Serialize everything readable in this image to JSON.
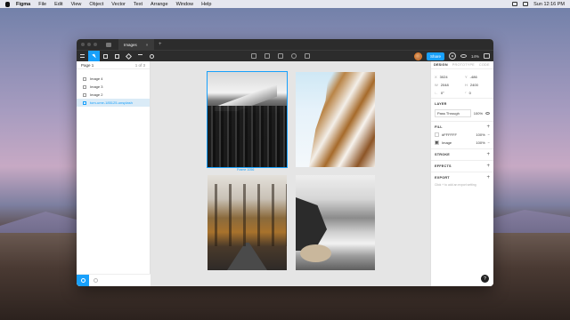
{
  "menubar": {
    "app_name": "Figma",
    "items": [
      "File",
      "Edit",
      "View",
      "Object",
      "Vector",
      "Text",
      "Arrange",
      "Window",
      "Help"
    ],
    "clock": "Sun 12:16 PM"
  },
  "window": {
    "tab_title": "Images",
    "tab_close": "×",
    "new_tab": "+"
  },
  "toolbar": {
    "share_label": "Share",
    "zoom": "14%"
  },
  "layers": {
    "page_label": "Page 1",
    "page_count": "1 of 3",
    "items": [
      {
        "label": "Image 4"
      },
      {
        "label": "Image 3"
      },
      {
        "label": "Image 2"
      },
      {
        "label": "tom-ume-185125-unsplash"
      }
    ]
  },
  "canvas": {
    "selection_caption": "Frame 1056"
  },
  "properties": {
    "tabs": [
      "DESIGN",
      "PROTOTYPE",
      "CODE"
    ],
    "x_label": "X",
    "x_value": "3024",
    "y_label": "Y",
    "y_value": "-486",
    "w_label": "W",
    "w_value": "2048",
    "h_label": "H",
    "h_value": "2400",
    "r_label": "∟",
    "r_value": "0°",
    "c_label": "◜",
    "c_value": "0",
    "layer_title": "LAYER",
    "blend_mode": "Pass Through",
    "layer_opacity": "100%",
    "fill_title": "FILL",
    "fills": [
      {
        "value": "#FFFFFF",
        "opacity": "100%",
        "swatch": "white"
      },
      {
        "value": "Image",
        "opacity": "100%",
        "swatch": "image"
      }
    ],
    "stroke_title": "STROKE",
    "effects_title": "EFFECTS",
    "export_title": "EXPORT",
    "export_hint": "Click + to add an export setting",
    "help_label": "?"
  },
  "colors": {
    "accent": "#18a0fb",
    "chrome": "#2c2c2c",
    "canvas": "#e5e5e5"
  }
}
